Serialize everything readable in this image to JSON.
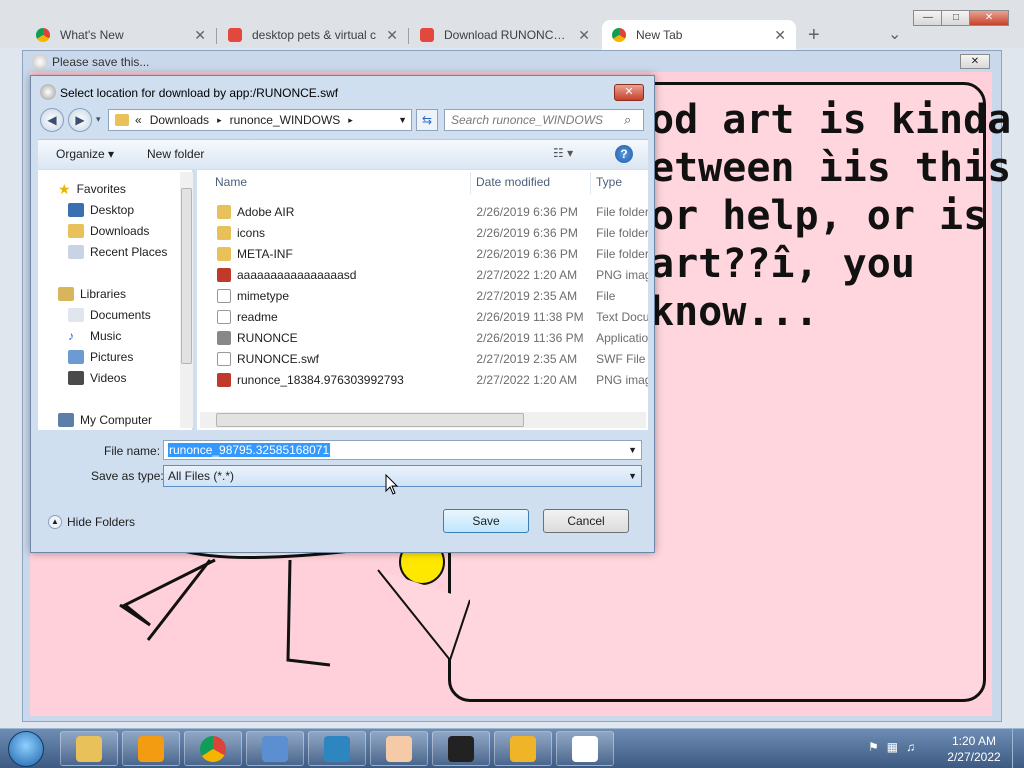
{
  "browser": {
    "tabs": [
      {
        "title": "What's New",
        "icon": "chrome-icon"
      },
      {
        "title": "desktop pets & virtual c",
        "icon": "itch-icon"
      },
      {
        "title": "Download RUNONCE (r",
        "icon": "itch-icon"
      },
      {
        "title": "New Tab",
        "icon": "chrome-icon"
      }
    ],
    "new_tab": "+",
    "tab_menu": "⌄",
    "window_controls": {
      "minimize": "—",
      "maximize": "□",
      "close": "✕"
    }
  },
  "flash_window": {
    "title": "Please save this...",
    "close": "✕",
    "story_text": "od art is kinda\netween ìis this\nor help, or is\nart??î, you\nknow..."
  },
  "dialog": {
    "title": "Select location for download by app:/RUNONCE.swf",
    "close": "✕",
    "breadcrumb": [
      "«",
      "Downloads",
      "▸",
      "runonce_WINDOWS",
      "▸"
    ],
    "search_placeholder": "Search runonce_WINDOWS",
    "organize": "Organize ▾",
    "new_folder": "New folder",
    "view_icon": "☷ ▾",
    "help": "?",
    "nav": {
      "favorites": "Favorites",
      "favorites_items": [
        "Desktop",
        "Downloads",
        "Recent Places"
      ],
      "libraries": "Libraries",
      "libraries_items": [
        "Documents",
        "Music",
        "Pictures",
        "Videos"
      ],
      "computer": "My Computer"
    },
    "columns": {
      "name": "Name",
      "date": "Date modified",
      "type": "Type"
    },
    "files": [
      {
        "name": "Adobe AIR",
        "date": "2/26/2019 6:36 PM",
        "type": "File folder",
        "icon": "folder-icon"
      },
      {
        "name": "icons",
        "date": "2/26/2019 6:36 PM",
        "type": "File folder",
        "icon": "folder-icon"
      },
      {
        "name": "META-INF",
        "date": "2/26/2019 6:36 PM",
        "type": "File folder",
        "icon": "folder-icon"
      },
      {
        "name": "aaaaaaaaaaaaaaaasd",
        "date": "2/27/2022 1:20 AM",
        "type": "PNG image",
        "icon": "image-icon"
      },
      {
        "name": "mimetype",
        "date": "2/27/2019 2:35 AM",
        "type": "File",
        "icon": "file-icon"
      },
      {
        "name": "readme",
        "date": "2/26/2019 11:38 PM",
        "type": "Text Document",
        "icon": "file-icon"
      },
      {
        "name": "RUNONCE",
        "date": "2/26/2019 11:36 PM",
        "type": "Application",
        "icon": "app-icon"
      },
      {
        "name": "RUNONCE.swf",
        "date": "2/27/2019 2:35 AM",
        "type": "SWF File",
        "icon": "file-icon"
      },
      {
        "name": "runonce_18384.976303992793",
        "date": "2/27/2022 1:20 AM",
        "type": "PNG image",
        "icon": "image-icon"
      }
    ],
    "file_name_label": "File name:",
    "file_name_value": "runonce_98795.32585168071",
    "save_type_label": "Save as type:",
    "save_type_value": "All Files (*.*)",
    "hide_folders": "Hide Folders",
    "save": "Save",
    "cancel": "Cancel"
  },
  "taskbar": {
    "start": "start-orb",
    "apps": [
      "explorer-icon",
      "media-player-icon",
      "chrome-icon",
      "control-panel-icon",
      "photo-viewer-icon",
      "paint-icon",
      "7zip-icon",
      "app-icon",
      "bunny-icon"
    ],
    "time": "1:20 AM",
    "date": "2/27/2022"
  }
}
